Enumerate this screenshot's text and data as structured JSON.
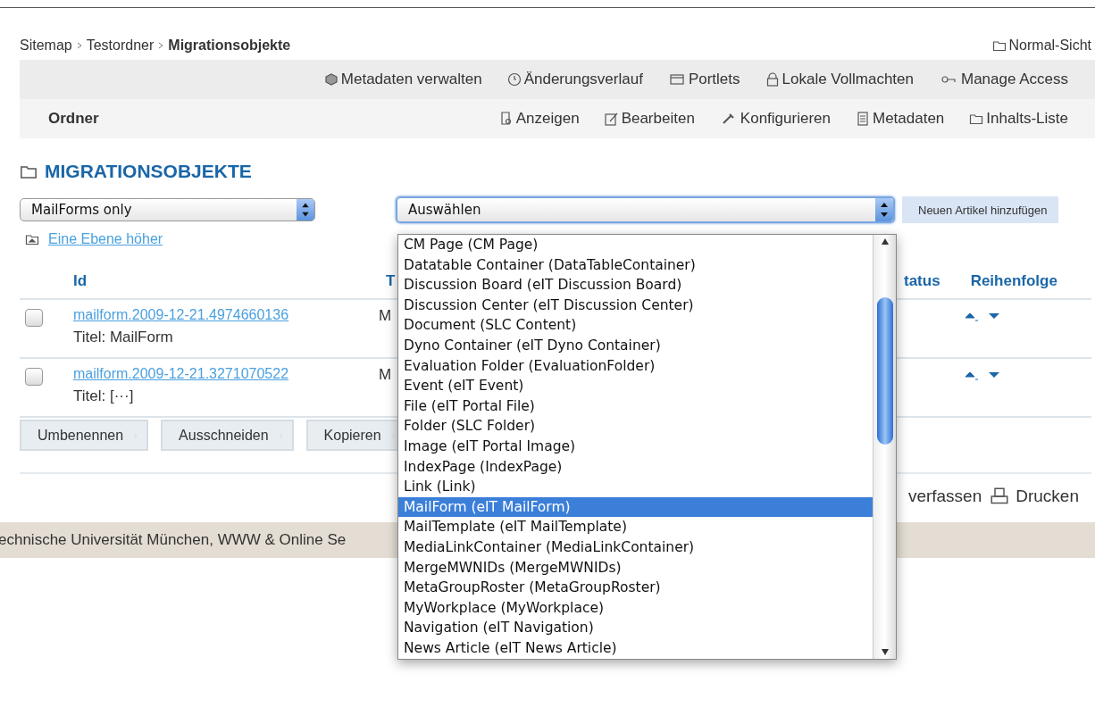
{
  "breadcrumb": [
    {
      "label": "Sitemap",
      "current": false
    },
    {
      "label": "Testordner",
      "current": false
    },
    {
      "label": "Migrationsobjekte",
      "current": true
    }
  ],
  "view_link": "Normal-Sicht",
  "toolbar_top": [
    "Metadaten verwalten",
    "Änderungsverlauf",
    "Portlets",
    "Lokale Vollmachten",
    "Manage Access"
  ],
  "toolbar_bottom": {
    "title": "Ordner",
    "items": [
      "Anzeigen",
      "Bearbeiten",
      "Konfigurieren",
      "Metadaten",
      "Inhalts-Liste"
    ]
  },
  "heading": "MIGRATIONSOBJEKTE",
  "filter_select": {
    "value": "MailForms only"
  },
  "up_link": "Eine Ebene höher",
  "add_select": {
    "value": "Auswählen",
    "open": true,
    "options": [
      {
        "label": "CM Page (CM Page)",
        "selected": false
      },
      {
        "label": "Datatable Container (DataTableContainer)",
        "selected": false
      },
      {
        "label": "Discussion Board (eIT Discussion Board)",
        "selected": false
      },
      {
        "label": "Discussion Center (eIT Discussion Center)",
        "selected": false
      },
      {
        "label": "Document (SLC Content)",
        "selected": false
      },
      {
        "label": "Dyno Container (eIT Dyno Container)",
        "selected": false
      },
      {
        "label": "Evaluation Folder (EvaluationFolder)",
        "selected": false
      },
      {
        "label": "Event (eIT Event)",
        "selected": false
      },
      {
        "label": "File (eIT Portal File)",
        "selected": false
      },
      {
        "label": "Folder (SLC Folder)",
        "selected": false
      },
      {
        "label": "Image (eIT Portal Image)",
        "selected": false
      },
      {
        "label": "IndexPage (IndexPage)",
        "selected": false
      },
      {
        "label": "Link (Link)",
        "selected": false
      },
      {
        "label": "MailForm (eIT MailForm)",
        "selected": true
      },
      {
        "label": "MailTemplate (eIT MailTemplate)",
        "selected": false
      },
      {
        "label": "MediaLinkContainer (MediaLinkContainer)",
        "selected": false
      },
      {
        "label": "MergeMWNIDs (MergeMWNIDs)",
        "selected": false
      },
      {
        "label": "MetaGroupRoster (MetaGroupRoster)",
        "selected": false
      },
      {
        "label": "MyWorkplace (MyWorkplace)",
        "selected": false
      },
      {
        "label": "Navigation (eIT Navigation)",
        "selected": false
      },
      {
        "label": "News Article (eIT News Article)",
        "selected": false
      }
    ]
  },
  "add_button": "Neuen Artikel hinzufügen",
  "table": {
    "columns": [
      "Id",
      "T",
      "tatus",
      "Reihenfolge"
    ],
    "rows": [
      {
        "checked": false,
        "id": "mailform.2009-12-21.4974660136",
        "title": "Titel: MailForm",
        "column_2": "M"
      },
      {
        "checked": false,
        "id": "mailform.2009-12-21.3271070522",
        "title": "Titel: [···]",
        "column_2": "M"
      }
    ]
  },
  "actions": [
    "Umbenennen",
    "Ausschneiden",
    "Kopieren"
  ],
  "footer_links": [
    "verfassen",
    "Drucken"
  ],
  "footer": "echnische Universität München, WWW & Online Se"
}
